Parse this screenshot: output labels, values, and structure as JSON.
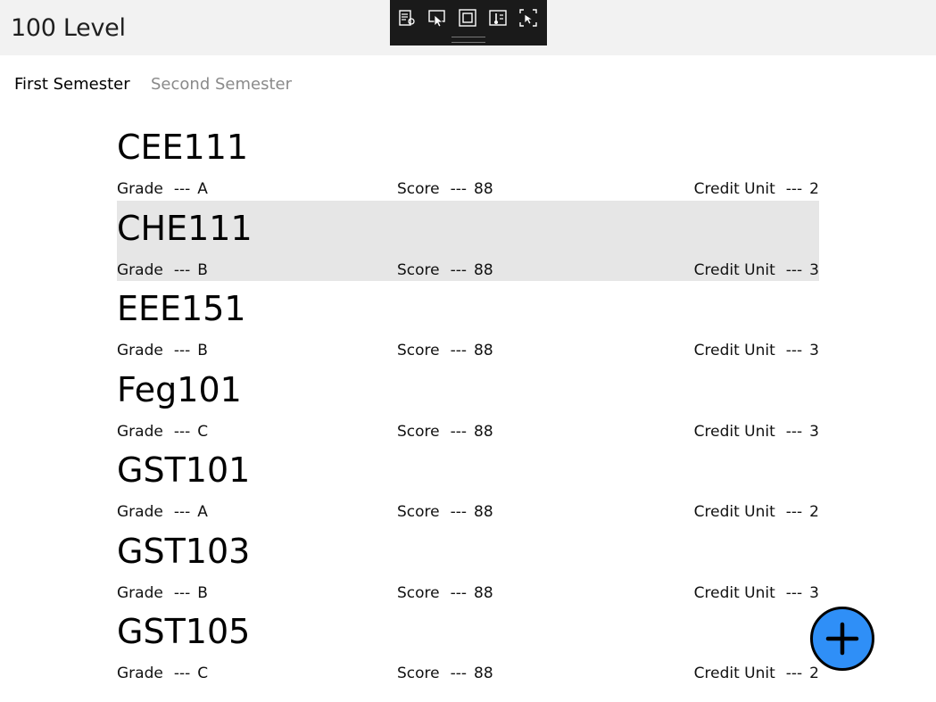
{
  "header": {
    "title": "100 Level"
  },
  "debug_toolbar": {
    "icons": [
      "live-visual-tree-icon",
      "select-element-icon",
      "display-layout-adorners-icon",
      "track-focus-icon",
      "show-binding-failures-icon"
    ]
  },
  "tabs": [
    {
      "label": "First Semester",
      "selected": true
    },
    {
      "label": "Second Semester",
      "selected": false
    }
  ],
  "labels": {
    "grade": "Grade",
    "score": "Score",
    "credit_unit": "Credit Unit",
    "separator": "---"
  },
  "courses": [
    {
      "code": "CEE111",
      "grade": "A",
      "score": "88",
      "credit_unit": "2",
      "selected": false
    },
    {
      "code": "CHE111",
      "grade": "B",
      "score": "88",
      "credit_unit": "3",
      "selected": true
    },
    {
      "code": "EEE151",
      "grade": "B",
      "score": "88",
      "credit_unit": "3",
      "selected": false
    },
    {
      "code": "Feg101",
      "grade": "C",
      "score": "88",
      "credit_unit": "3",
      "selected": false
    },
    {
      "code": "GST101",
      "grade": "A",
      "score": "88",
      "credit_unit": "2",
      "selected": false
    },
    {
      "code": "GST103",
      "grade": "B",
      "score": "88",
      "credit_unit": "3",
      "selected": false
    },
    {
      "code": "GST105",
      "grade": "C",
      "score": "88",
      "credit_unit": "2",
      "selected": false
    }
  ],
  "fab": {
    "icon": "plus-icon",
    "color": "#2f8ff7"
  }
}
